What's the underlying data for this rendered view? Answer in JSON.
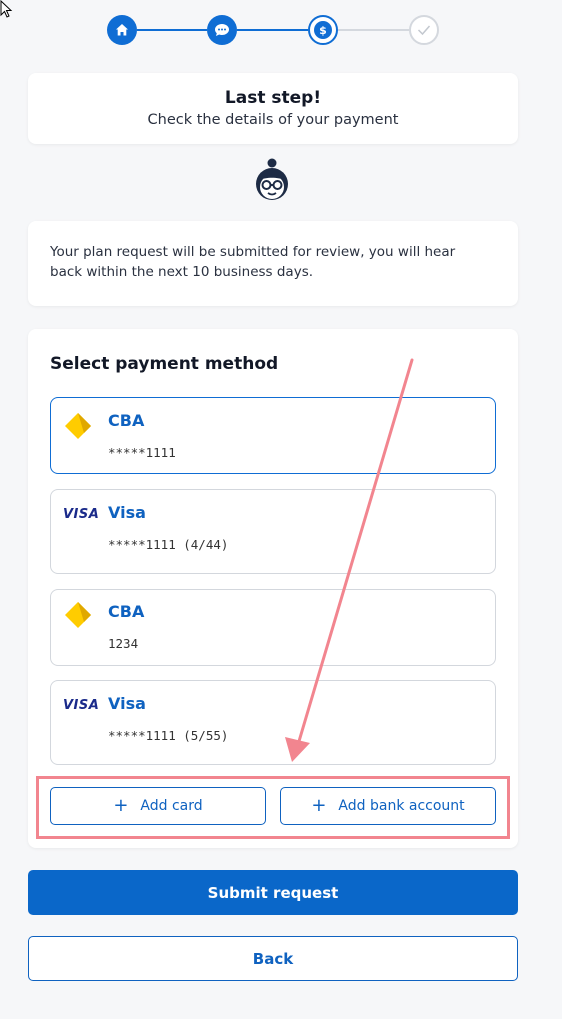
{
  "header": {
    "title": "Last step!",
    "subtitle": "Check the details of your payment"
  },
  "stepper": {
    "steps": [
      {
        "icon": "home-icon",
        "state": "done"
      },
      {
        "icon": "chat-icon",
        "state": "done"
      },
      {
        "icon": "dollar-icon",
        "state": "current"
      },
      {
        "icon": "check-icon",
        "state": "pending"
      }
    ]
  },
  "info": {
    "text": "Your plan request will be submitted for review, you will hear back within the next 10 business days."
  },
  "payment": {
    "title": "Select payment method",
    "methods": [
      {
        "logo": "cba-logo",
        "name": "CBA",
        "number": "*****1111",
        "selected": true
      },
      {
        "logo": "visa-logo",
        "name": "Visa",
        "number": "*****1111 (4/44)",
        "selected": false
      },
      {
        "logo": "cba-logo",
        "name": "CBA",
        "number": "1234",
        "selected": false
      },
      {
        "logo": "visa-logo",
        "name": "Visa",
        "number": "*****1111 (5/55)",
        "selected": false
      }
    ],
    "visa_logo_text": "VISA",
    "add_card": "Add card",
    "add_bank": "Add bank account",
    "plus": "+"
  },
  "actions": {
    "submit": "Submit request",
    "back": "Back"
  },
  "colors": {
    "primary": "#0f6dd4",
    "annotation": "#f2858f"
  }
}
